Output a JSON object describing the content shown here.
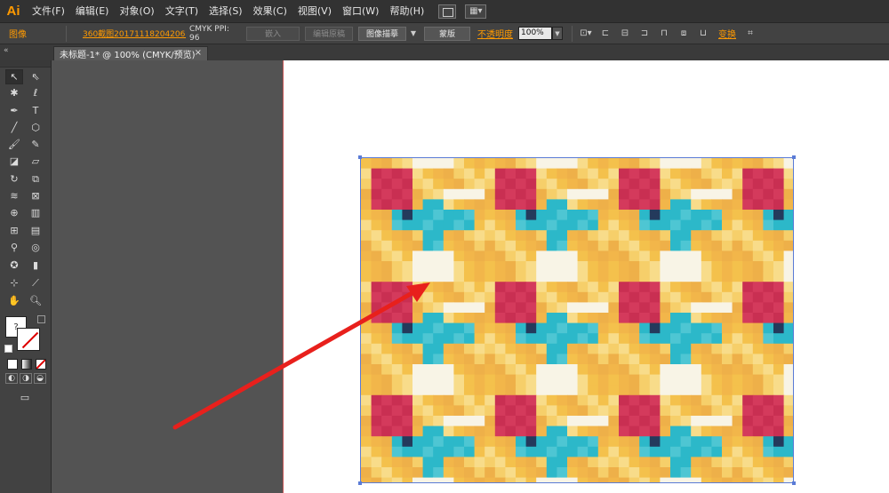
{
  "app": {
    "logo": "Ai"
  },
  "menu": {
    "items": [
      "文件(F)",
      "编辑(E)",
      "对象(O)",
      "文字(T)",
      "选择(S)",
      "效果(C)",
      "视图(V)",
      "窗口(W)",
      "帮助(H)"
    ]
  },
  "control_bar": {
    "object_type": "图像",
    "linked_file": "360截图20171118204206...",
    "color_info": "CMYK PPI: 96",
    "embed_label": "嵌入",
    "edit_original_label": "编辑原稿",
    "image_trace_label": "图像描摹",
    "mask_label": "蒙版",
    "opacity_label": "不透明度",
    "opacity_value": "100%",
    "transform_label": "变换"
  },
  "document": {
    "tab_title": "未标题-1* @ 100% (CMYK/预览)",
    "close_glyph": "×"
  },
  "tools": {
    "unknown_fill_glyph": "?"
  },
  "colors": {
    "accent_orange": "#ff9a00",
    "selection_blue": "#5a7bd6",
    "arrow_red": "#e8201c",
    "pattern_red": "#d43a5c",
    "pattern_yellow": "#f4c14c",
    "pattern_cyan": "#2cb8c9",
    "pattern_cream": "#f8f4e6"
  }
}
